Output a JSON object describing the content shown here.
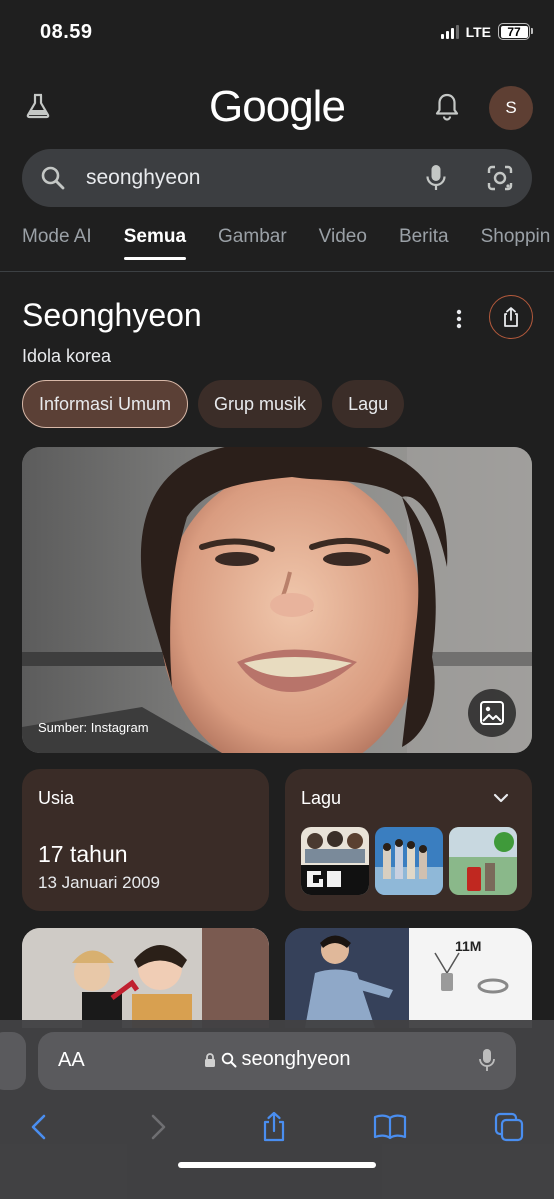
{
  "status": {
    "time": "08.59",
    "network": "LTE",
    "battery": "77"
  },
  "header": {
    "logo": "Google",
    "avatar_letter": "S"
  },
  "search": {
    "query": "seonghyeon"
  },
  "tabs": [
    {
      "label": "Mode AI"
    },
    {
      "label": "Semua"
    },
    {
      "label": "Gambar"
    },
    {
      "label": "Video"
    },
    {
      "label": "Berita"
    },
    {
      "label": "Shoppin"
    }
  ],
  "knowledge_panel": {
    "title": "Seonghyeon",
    "subtitle": "Idola korea",
    "chips": [
      {
        "label": "Informasi Umum"
      },
      {
        "label": "Grup musik"
      },
      {
        "label": "Lagu"
      }
    ],
    "image_caption": "Sumber: Instagram",
    "age_card": {
      "label": "Usia",
      "value": "17 tahun",
      "date": "13 Januari 2009"
    },
    "songs_card": {
      "label": "Lagu"
    }
  },
  "image_text": {
    "bottom_card_count": "11M"
  },
  "browser": {
    "url": "seonghyeon",
    "aa_label": "AA"
  },
  "colors": {
    "background": "#1f1f1f",
    "chip_bg": "#3b2d28",
    "card_bg": "#3a2c27",
    "accent": "#b45a3c",
    "toolbar_blue": "#4a8ef0"
  }
}
